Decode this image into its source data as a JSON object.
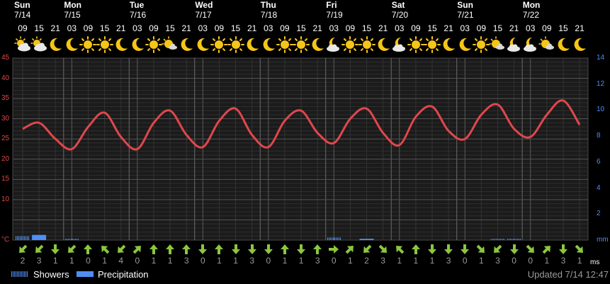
{
  "days": [
    {
      "name": "Sun",
      "date": "7/14"
    },
    {
      "name": "Mon",
      "date": "7/15"
    },
    {
      "name": "Tue",
      "date": "7/16"
    },
    {
      "name": "Wed",
      "date": "7/17"
    },
    {
      "name": "Thu",
      "date": "7/18"
    },
    {
      "name": "Fri",
      "date": "7/19"
    },
    {
      "name": "Sat",
      "date": "7/20"
    },
    {
      "name": "Sun",
      "date": "7/21"
    },
    {
      "name": "Mon",
      "date": "7/22"
    }
  ],
  "hours": [
    "09",
    "15",
    "21",
    "03",
    "09",
    "15",
    "21",
    "03",
    "09",
    "15",
    "21",
    "03",
    "09",
    "15",
    "21",
    "03",
    "09",
    "15",
    "21",
    "03",
    "09",
    "15",
    "21",
    "03",
    "09",
    "15",
    "21",
    "03",
    "09",
    "15",
    "21",
    "03",
    "09",
    "15",
    "21"
  ],
  "weather_icons": [
    "partly-sunny-icon",
    "partly-sunny-icon",
    "moon-icon",
    "moon-icon",
    "sun-icon",
    "sun-icon",
    "moon-icon",
    "moon-icon",
    "sun-icon",
    "partly-cloudy-sun-icon",
    "moon-icon",
    "moon-icon",
    "sun-icon",
    "sun-icon",
    "moon-icon",
    "moon-icon",
    "sun-icon",
    "sun-icon",
    "moon-icon",
    "cloudy-moon-icon",
    "sun-icon",
    "sun-icon",
    "moon-icon",
    "cloudy-moon-icon",
    "sun-icon",
    "sun-icon",
    "moon-icon",
    "moon-icon",
    "sun-icon",
    "partly-cloudy-sun-icon",
    "cloudy-moon-icon",
    "cloudy-moon-icon",
    "partly-cloudy-sun-icon",
    "moon-icon",
    "moon-icon"
  ],
  "axis": {
    "left_ticks": [
      "45",
      "40",
      "35",
      "30",
      "25",
      "20",
      "15",
      "10",
      "°C"
    ],
    "right_ticks": [
      "14",
      "12",
      "10",
      "8",
      "6",
      "4",
      "2",
      "mm"
    ]
  },
  "wind": {
    "unit": "ms",
    "speeds": [
      "2",
      "3",
      "1",
      "1",
      "0",
      "1",
      "4",
      "0",
      "1",
      "1",
      "3",
      "0",
      "1",
      "1",
      "3",
      "0",
      "1",
      "1",
      "3",
      "0",
      "1",
      "2",
      "3",
      "1",
      "1",
      "1",
      "3",
      "0",
      "1",
      "3",
      "0",
      "0",
      "1",
      "3",
      "1"
    ],
    "directions": [
      "SW",
      "SW",
      "S",
      "SW",
      "N",
      "NW",
      "SW",
      "NE",
      "N",
      "N",
      "N",
      "S",
      "N",
      "S",
      "S",
      "S",
      "N",
      "S",
      "N",
      "E",
      "NE",
      "SW",
      "SE",
      "NW",
      "N",
      "S",
      "S",
      "S",
      "SE",
      "SW",
      "S",
      "SE",
      "NE",
      "S",
      "SE"
    ]
  },
  "legend": {
    "showers": "Showers",
    "precipitation": "Precipitation"
  },
  "updated": "Updated 7/14 12:47",
  "chart_data": {
    "type": "line",
    "series": [
      {
        "name": "Temperature",
        "unit": "°C",
        "color": "#e0474c",
        "x": [
          "09",
          "15",
          "21",
          "03",
          "09",
          "15",
          "21",
          "03",
          "09",
          "15",
          "21",
          "03",
          "09",
          "15",
          "21",
          "03",
          "09",
          "15",
          "21",
          "03",
          "09",
          "15",
          "21",
          "03",
          "09",
          "15",
          "21",
          "03",
          "09",
          "15",
          "21",
          "03",
          "09",
          "15",
          "21"
        ],
        "values": [
          27.5,
          29.0,
          25.0,
          22.5,
          28.0,
          31.5,
          25.5,
          22.5,
          29.0,
          32.0,
          26.0,
          23.0,
          29.5,
          32.5,
          26.0,
          23.0,
          29.5,
          32.0,
          26.5,
          24.0,
          30.0,
          32.5,
          26.5,
          23.5,
          30.5,
          33.0,
          27.0,
          25.0,
          31.0,
          33.5,
          27.5,
          25.5,
          31.0,
          34.5,
          28.5
        ]
      },
      {
        "name": "Showers",
        "unit": "mm",
        "values": [
          0.3,
          0.3,
          0,
          0.1,
          0,
          0,
          0,
          0,
          0,
          0,
          0,
          0,
          0,
          0,
          0,
          0,
          0,
          0,
          0,
          0.2,
          0,
          0,
          0,
          0,
          0,
          0,
          0,
          0,
          0,
          0.1,
          0.1,
          0,
          0,
          0,
          0
        ]
      },
      {
        "name": "Precipitation",
        "unit": "mm",
        "values": [
          0,
          0.4,
          0,
          0,
          0,
          0,
          0,
          0,
          0,
          0,
          0,
          0,
          0,
          0,
          0,
          0,
          0,
          0,
          0,
          0,
          0,
          0.1,
          0,
          0,
          0,
          0,
          0,
          0,
          0,
          0,
          0,
          0,
          0,
          0,
          0
        ]
      }
    ],
    "ylim_left": [
      0,
      45
    ],
    "ylim_right": [
      0,
      14
    ],
    "grid": true,
    "colors": {
      "temperature": "#e0474c",
      "showers": "#4f8ef5",
      "precipitation": "#4f8ef5",
      "left_axis": "#e04646",
      "right_axis": "#4f8ef5"
    }
  }
}
